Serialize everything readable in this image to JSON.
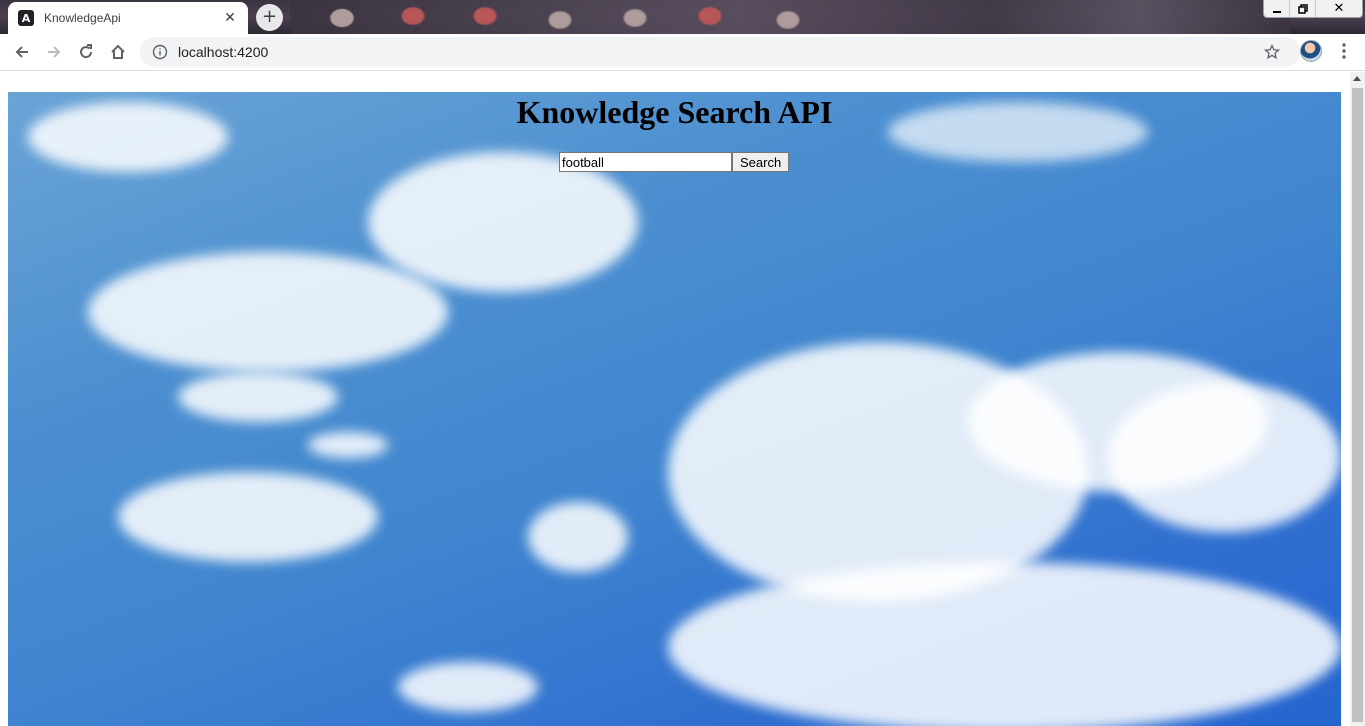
{
  "browser": {
    "tab": {
      "title": "KnowledgeApi",
      "favicon": "angular-logo-icon",
      "close_glyph": "✕"
    },
    "new_tab_glyph": "+",
    "window_controls": {
      "minimize": "🗕",
      "restore": "🗗",
      "close": "✕"
    },
    "address_bar": {
      "url": "localhost:4200",
      "icon": "info-icon"
    }
  },
  "page": {
    "title": "Knowledge Search API",
    "search": {
      "value": "football",
      "button_label": "Search"
    },
    "background": "sky-with-clouds"
  },
  "colors": {
    "sky_top": "#6aa4d6",
    "sky_bottom": "#2565cf",
    "tabstrip": "#3a3440"
  }
}
